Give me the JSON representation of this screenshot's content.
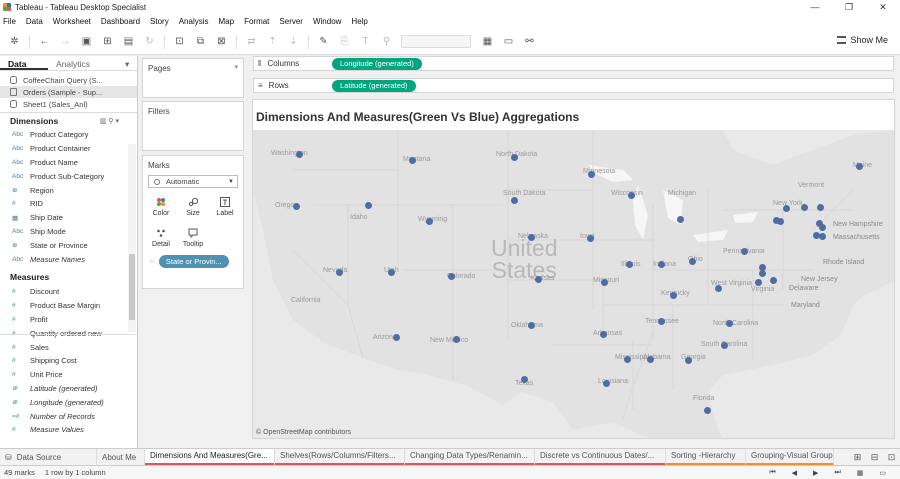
{
  "window": {
    "title": "Tableau - Tableau Desktop Specialist",
    "controls": [
      "—",
      "❐",
      "✕"
    ]
  },
  "menu": [
    "File",
    "Data",
    "Worksheet",
    "Dashboard",
    "Story",
    "Analysis",
    "Map",
    "Format",
    "Server",
    "Window",
    "Help"
  ],
  "toolbar": {
    "show_me": "Show Me"
  },
  "left_pane": {
    "tabs": [
      "Data",
      "Analytics"
    ],
    "data_sources": [
      "CoffeeChain Query (S...",
      "Orders (Sample - Sup...",
      "Sheet1 (Sales_Anl)"
    ],
    "dimensions_label": "Dimensions",
    "dimensions": [
      {
        "icon": "Abc",
        "label": "Product Category"
      },
      {
        "icon": "Abc",
        "label": "Product Container"
      },
      {
        "icon": "Abc",
        "label": "Product Name"
      },
      {
        "icon": "Abc",
        "label": "Product Sub-Category"
      },
      {
        "icon": "⊕",
        "label": "Region"
      },
      {
        "icon": "#",
        "label": "RID"
      },
      {
        "icon": "▦",
        "label": "Ship Date"
      },
      {
        "icon": "Abc",
        "label": "Ship Mode"
      },
      {
        "icon": "⊕",
        "label": "State or Province"
      },
      {
        "icon": "Abc",
        "label": "Measure Names"
      }
    ],
    "measures_label": "Measures",
    "measures": [
      {
        "icon": "#",
        "label": "Discount"
      },
      {
        "icon": "#",
        "label": "Product Base Margin"
      },
      {
        "icon": "#",
        "label": "Profit"
      },
      {
        "icon": "#",
        "label": "Quantity ordered new"
      },
      {
        "icon": "#",
        "label": "Sales"
      },
      {
        "icon": "#",
        "label": "Shipping Cost"
      },
      {
        "icon": "#",
        "label": "Unit Price"
      },
      {
        "icon": "⊕",
        "label": "Latitude (generated)"
      },
      {
        "icon": "⊕",
        "label": "Longitude (generated)"
      },
      {
        "icon": "=#",
        "label": "Number of Records"
      },
      {
        "icon": "#",
        "label": "Measure Values"
      }
    ]
  },
  "cards": {
    "pages": "Pages",
    "filters": "Filters",
    "marks": "Marks",
    "marks_type": "Automatic",
    "mark_buttons": [
      "Color",
      "Size",
      "Label",
      "Detail",
      "Tooltip"
    ],
    "detail_pill": "State or Provin..."
  },
  "shelves": {
    "columns_label": "Columns",
    "columns_pill": "Longitude (generated)",
    "rows_label": "Rows",
    "rows_pill": "Latitude (generated)"
  },
  "viz": {
    "title": "Dimensions And Measures(Green Vs Blue) Aggregations",
    "country_label_1": "United",
    "country_label_2": "States",
    "attribution": "© OpenStreetMap contributors",
    "dot_color": "#4e6ea3",
    "place_labels": [
      "New Hampshire",
      "Massachusetts",
      "Rhode Island",
      "New Jersey",
      "Delaware",
      "Maryland"
    ],
    "state_labels": [
      "Washington",
      "Montana",
      "North Dakota",
      "Minnesota",
      "Oregon",
      "Idaho",
      "South Dakota",
      "Wisconsin",
      "Michigan",
      "Wyoming",
      "Nebraska",
      "Iowa",
      "Nevada",
      "Utah",
      "Colorado",
      "Kansas",
      "Missouri",
      "Illinois",
      "Indiana",
      "Ohio",
      "Pennsylvania",
      "New York",
      "Vermont",
      "Maine",
      "California",
      "Arizona",
      "New Mexico",
      "Oklahoma",
      "Arkansas",
      "Tennessee",
      "Kentucky",
      "West Virginia",
      "Virginia",
      "North Carolina",
      "South Carolina",
      "Mississippi",
      "Alabama",
      "Georgia",
      "Louisiana",
      "Texas",
      "Florida"
    ]
  },
  "sheet_tabs": [
    {
      "label": "Data Source",
      "style": ""
    },
    {
      "label": "About Me",
      "style": ""
    },
    {
      "label": "Dimensions And Measures(Gre...",
      "style": "active"
    },
    {
      "label": "Shelves(Rows/Columns/Filters...",
      "style": "bred"
    },
    {
      "label": "Changing Data Types/Renamin...",
      "style": "bred"
    },
    {
      "label": "Discrete vs Continuous Dates/...",
      "style": "bred"
    },
    {
      "label": "Sorting -Hierarchy",
      "style": "borange"
    },
    {
      "label": "Grouping-Visual Group",
      "style": "borange"
    }
  ],
  "status": {
    "marks": "49 marks",
    "dims": "1 row by 1 column"
  }
}
